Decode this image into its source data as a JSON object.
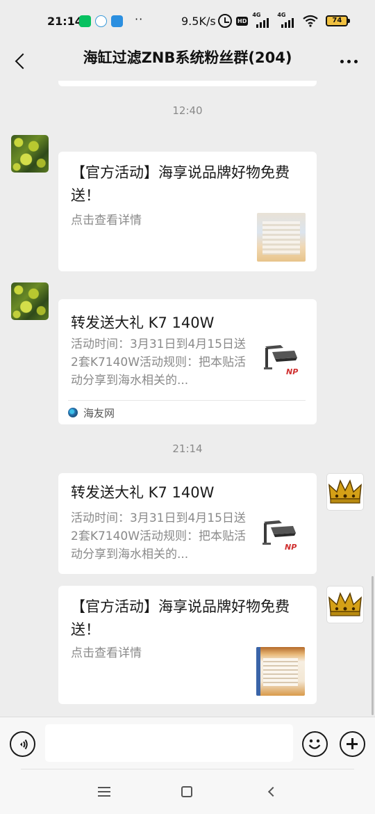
{
  "status_bar": {
    "time": "21:14",
    "dots": "··",
    "net_speed": "9.5K/s",
    "hd": "HD",
    "net1": "4G",
    "net2": "4G",
    "battery": "74",
    "app_icons": [
      "wechat-icon",
      "browser-icon",
      "cloud-icon"
    ]
  },
  "header": {
    "title": "海缸过滤ZNB系统粉丝群(204)",
    "back_icon": "chevron-left-icon",
    "more_icon": "more-dots-icon"
  },
  "messages": [
    {
      "timestamp": "12:40",
      "sender": "other",
      "avatar": "coral-avatar",
      "card": {
        "title": "【官方活动】海享说品牌好物免费送！",
        "desc": "点击查看详情"
      }
    },
    {
      "sender": "other",
      "avatar": "coral-avatar",
      "card": {
        "title": "转发送大礼 K7 140W",
        "desc": "活动时间：3月31日到4月15日送2套K7140W活动规则：把本贴活动分享到海水相关的...",
        "source": "海友网"
      }
    },
    {
      "timestamp": "21:14",
      "sender": "self",
      "avatar": "crown-avatar",
      "card": {
        "title": "转发送大礼 K7 140W",
        "desc": "活动时间：3月31日到4月15日送2套K7140W活动规则：把本贴活动分享到海水相关的..."
      }
    },
    {
      "sender": "self",
      "avatar": "crown-avatar",
      "card": {
        "title": "【官方活动】海享说品牌好物免费送！",
        "desc": "点击查看详情"
      }
    }
  ],
  "input_bar": {
    "placeholder": "",
    "value": ""
  }
}
